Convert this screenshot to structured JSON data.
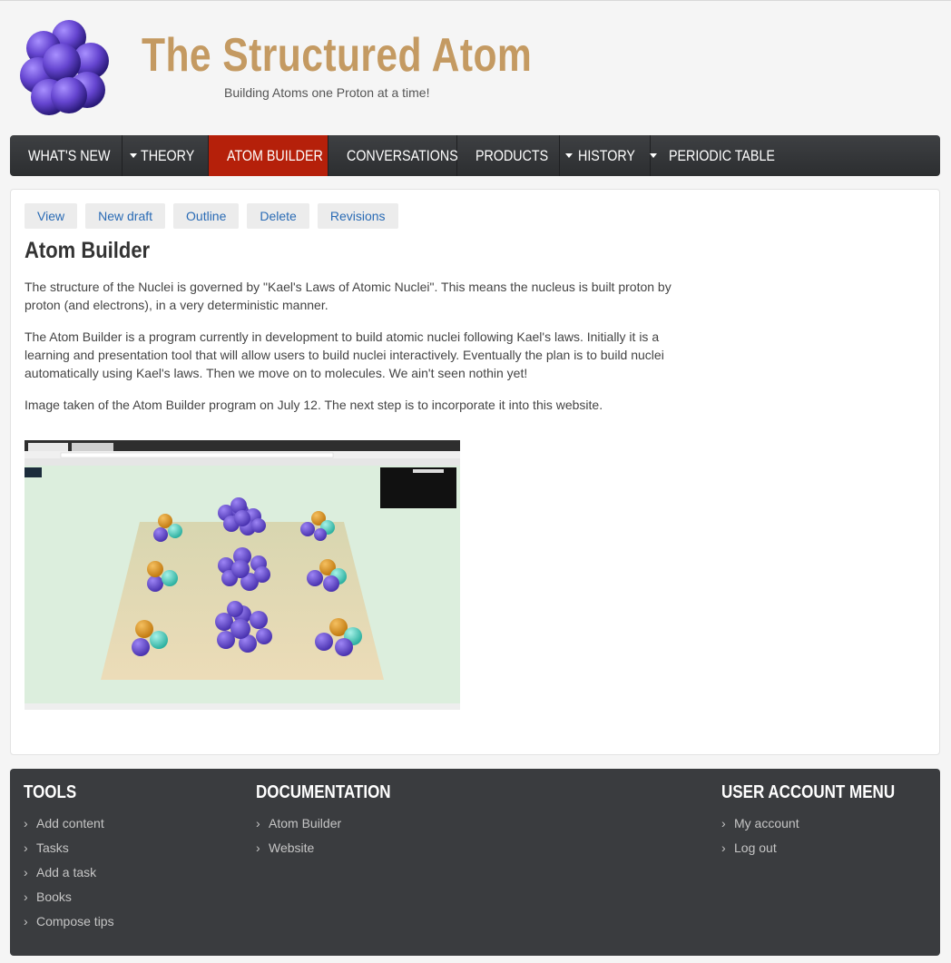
{
  "site": {
    "name": "The Structured Atom",
    "slogan": "Building Atoms one Proton at a time!"
  },
  "nav": [
    {
      "label": "WHAT'S NEW",
      "dropdown": true,
      "active": false
    },
    {
      "label": "THEORY",
      "dropdown": true,
      "active": false
    },
    {
      "label": "ATOM BUILDER",
      "dropdown": false,
      "active": true
    },
    {
      "label": "CONVERSATIONS",
      "dropdown": false,
      "active": false
    },
    {
      "label": "PRODUCTS",
      "dropdown": true,
      "active": false
    },
    {
      "label": "HISTORY",
      "dropdown": true,
      "active": false
    },
    {
      "label": "PERIODIC TABLE",
      "dropdown": false,
      "active": false
    }
  ],
  "tabs": [
    "View",
    "New draft",
    "Outline",
    "Delete",
    "Revisions"
  ],
  "page": {
    "title": "Atom Builder",
    "paragraphs": [
      "The structure of the Nuclei is governed by \"Kael's Laws of Atomic Nuclei\".  This means the nucleus is built proton by proton (and electrons), in a very deterministic manner.",
      "The Atom Builder is a program currently in development to build atomic nuclei following Kael's laws.  Initially it is a learning and presentation tool that will allow users to build nuclei interactively.  Eventually the plan is to build nuclei automatically using Kael's laws.  Then we move on to molecules.  We ain't seen nothin yet!",
      "Image taken of the Atom Builder program on July 12.  The next step is to incorporate it into this website."
    ]
  },
  "footer": {
    "tools": {
      "heading": "TOOLS",
      "items": [
        "Add content",
        "Tasks",
        "Add a task",
        "Books",
        "Compose tips"
      ]
    },
    "documentation": {
      "heading": "DOCUMENTATION",
      "items": [
        "Atom Builder",
        "Website"
      ]
    },
    "user_menu": {
      "heading": "USER ACCOUNT MENU",
      "items": [
        "My account",
        "Log out"
      ]
    }
  },
  "colors": {
    "brand": "#c49a62",
    "nav_active": "#b5200a",
    "link": "#2a6bb5",
    "proton": "#6a4fc9",
    "footer_bg": "#3a3c3f"
  }
}
